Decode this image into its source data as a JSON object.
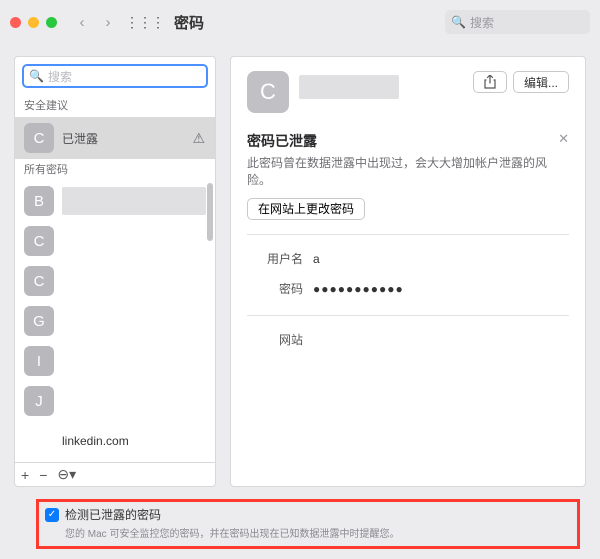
{
  "titlebar": {
    "title": "密码",
    "search_placeholder": "搜索"
  },
  "left": {
    "search_placeholder": "搜索",
    "section_recommend": "安全建议",
    "recommend_entry": {
      "letter": "C",
      "label": "已泄露"
    },
    "section_all": "所有密码",
    "items": [
      {
        "letter": "B",
        "label": ""
      },
      {
        "letter": "C",
        "label": ""
      },
      {
        "letter": "C",
        "label": ""
      },
      {
        "letter": "G",
        "label": ""
      },
      {
        "letter": "I",
        "label": ""
      },
      {
        "letter": "J",
        "label": ""
      },
      {
        "letter": "",
        "label": "linkedin.com"
      }
    ],
    "toolbar": {
      "add": "+",
      "remove": "−",
      "more": "⊖▾"
    }
  },
  "right": {
    "big_letter": "C",
    "share_icon": "􀈂",
    "edit_label": "编辑...",
    "notice_title": "密码已泄露",
    "notice_body": "此密码曾在数据泄露中出现过，会大大增加帐户泄露的风险。",
    "action_label": "在网站上更改密码",
    "username_label": "用户名",
    "username_value": "a",
    "password_label": "密码",
    "password_value": "●●●●●●●●●●●",
    "website_label": "网站",
    "website_value": ""
  },
  "footer": {
    "checkbox_label": "检测已泄露的密码",
    "desc": "您的 Mac 可安全监控您的密码，并在密码出现在已知数据泄露中时提醒您。"
  }
}
